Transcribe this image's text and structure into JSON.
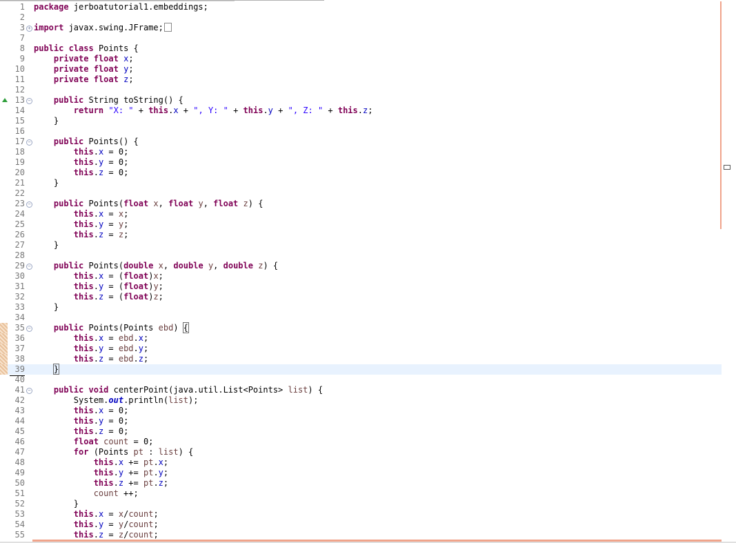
{
  "editor": {
    "lines": [
      {
        "n": "1",
        "html": "<span class='kw'>package</span> jerboatutorial1.embeddings;"
      },
      {
        "n": "2",
        "html": ""
      },
      {
        "n": "3",
        "html": "<span class='kw'>import</span> javax.swing.JFrame;",
        "fold": "plus",
        "collapsed": true
      },
      {
        "n": "7",
        "html": ""
      },
      {
        "n": "8",
        "html": "<span class='kw'>public</span> <span class='kw'>class</span> Points {"
      },
      {
        "n": "9",
        "html": "    <span class='kw'>private</span> <span class='kw'>float</span> <span class='fld'>x</span>;"
      },
      {
        "n": "10",
        "html": "    <span class='kw'>private</span> <span class='kw'>float</span> <span class='fld'>y</span>;"
      },
      {
        "n": "11",
        "html": "    <span class='kw'>private</span> <span class='kw'>float</span> <span class='fld'>z</span>;"
      },
      {
        "n": "12",
        "html": ""
      },
      {
        "n": "13",
        "html": "    <span class='kw'>public</span> String toString() {",
        "fold": "minus",
        "override": true
      },
      {
        "n": "14",
        "html": "        <span class='kw'>return</span> <span class='str'>\"X: \"</span> + <span class='kw'>this</span>.<span class='fld'>x</span> + <span class='str'>\", Y: \"</span> + <span class='kw'>this</span>.<span class='fld'>y</span> + <span class='str'>\", Z: \"</span> + <span class='kw'>this</span>.<span class='fld'>z</span>;"
      },
      {
        "n": "15",
        "html": "    }"
      },
      {
        "n": "16",
        "html": ""
      },
      {
        "n": "17",
        "html": "    <span class='kw'>public</span> Points() {",
        "fold": "minus"
      },
      {
        "n": "18",
        "html": "        <span class='kw'>this</span>.<span class='fld'>x</span> = 0;"
      },
      {
        "n": "19",
        "html": "        <span class='kw'>this</span>.<span class='fld'>y</span> = 0;"
      },
      {
        "n": "20",
        "html": "        <span class='kw'>this</span>.<span class='fld'>z</span> = 0;"
      },
      {
        "n": "21",
        "html": "    }"
      },
      {
        "n": "22",
        "html": ""
      },
      {
        "n": "23",
        "html": "    <span class='kw'>public</span> Points(<span class='kw'>float</span> <span class='var'>x</span>, <span class='kw'>float</span> <span class='var'>y</span>, <span class='kw'>float</span> <span class='var'>z</span>) {",
        "fold": "minus"
      },
      {
        "n": "24",
        "html": "        <span class='kw'>this</span>.<span class='fld'>x</span> = <span class='var'>x</span>;"
      },
      {
        "n": "25",
        "html": "        <span class='kw'>this</span>.<span class='fld'>y</span> = <span class='var'>y</span>;"
      },
      {
        "n": "26",
        "html": "        <span class='kw'>this</span>.<span class='fld'>z</span> = <span class='var'>z</span>;"
      },
      {
        "n": "27",
        "html": "    }"
      },
      {
        "n": "28",
        "html": ""
      },
      {
        "n": "29",
        "html": "    <span class='kw'>public</span> Points(<span class='kw'>double</span> <span class='var'>x</span>, <span class='kw'>double</span> <span class='var'>y</span>, <span class='kw'>double</span> <span class='var'>z</span>) {",
        "fold": "minus"
      },
      {
        "n": "30",
        "html": "        <span class='kw'>this</span>.<span class='fld'>x</span> = (<span class='kw'>float</span>)<span class='var'>x</span>;"
      },
      {
        "n": "31",
        "html": "        <span class='kw'>this</span>.<span class='fld'>y</span> = (<span class='kw'>float</span>)<span class='var'>y</span>;"
      },
      {
        "n": "32",
        "html": "        <span class='kw'>this</span>.<span class='fld'>z</span> = (<span class='kw'>float</span>)<span class='var'>z</span>;"
      },
      {
        "n": "33",
        "html": "    }"
      },
      {
        "n": "34",
        "html": ""
      },
      {
        "n": "35",
        "html": "    <span class='kw'>public</span> Points(Points <span class='var'>ebd</span>) <span class='bracket'>{</span>",
        "fold": "minus",
        "changed": true
      },
      {
        "n": "36",
        "html": "        <span class='kw'>this</span>.<span class='fld'>x</span> = <span class='var'>ebd</span>.<span class='fld'>x</span>;",
        "changed": true
      },
      {
        "n": "37",
        "html": "        <span class='kw'>this</span>.<span class='fld'>y</span> = <span class='var'>ebd</span>.<span class='fld'>y</span>;",
        "changed": true
      },
      {
        "n": "38",
        "html": "        <span class='kw'>this</span>.<span class='fld'>z</span> = <span class='var'>ebd</span>.<span class='fld'>z</span>;",
        "changed": true
      },
      {
        "n": "39",
        "html": "    <span class='bracket'>}</span><span class='caret'></span>",
        "current": true,
        "changed": true
      },
      {
        "n": "40",
        "html": ""
      },
      {
        "n": "41",
        "html": "    <span class='kw'>public</span> <span class='kw'>void</span> centerPoint(java.util.List&lt;Points&gt; <span class='var'>list</span>) {",
        "fold": "minus"
      },
      {
        "n": "42",
        "html": "        System.<span class='sfld'>out</span>.println(<span class='var'>list</span>);"
      },
      {
        "n": "43",
        "html": "        <span class='kw'>this</span>.<span class='fld'>x</span> = 0;"
      },
      {
        "n": "44",
        "html": "        <span class='kw'>this</span>.<span class='fld'>y</span> = 0;"
      },
      {
        "n": "45",
        "html": "        <span class='kw'>this</span>.<span class='fld'>z</span> = 0;"
      },
      {
        "n": "46",
        "html": "        <span class='kw'>float</span> <span class='var'>count</span> = 0;"
      },
      {
        "n": "47",
        "html": "        <span class='kw'>for</span> (Points <span class='var'>pt</span> : <span class='var'>list</span>) {"
      },
      {
        "n": "48",
        "html": "            <span class='kw'>this</span>.<span class='fld'>x</span> += <span class='var'>pt</span>.<span class='fld'>x</span>;"
      },
      {
        "n": "49",
        "html": "            <span class='kw'>this</span>.<span class='fld'>y</span> += <span class='var'>pt</span>.<span class='fld'>y</span>;"
      },
      {
        "n": "50",
        "html": "            <span class='kw'>this</span>.<span class='fld'>z</span> += <span class='var'>pt</span>.<span class='fld'>z</span>;"
      },
      {
        "n": "51",
        "html": "            <span class='var'>count</span> ++;"
      },
      {
        "n": "52",
        "html": "        }"
      },
      {
        "n": "53",
        "html": "        <span class='kw'>this</span>.<span class='fld'>x</span> = <span class='var'>x</span>/<span class='var'>count</span>;"
      },
      {
        "n": "54",
        "html": "        <span class='kw'>this</span>.<span class='fld'>y</span> = <span class='var'>y</span>/<span class='var'>count</span>;"
      },
      {
        "n": "55",
        "html": "        <span class='kw'>this</span>.<span class='fld'>z</span> = <span class='var'>z</span>/<span class='var'>count</span>;"
      }
    ]
  }
}
